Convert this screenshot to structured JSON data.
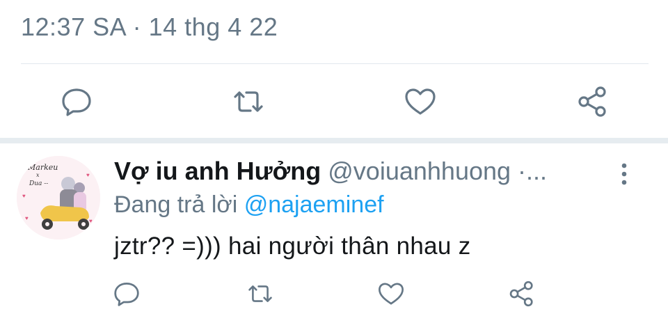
{
  "tweet": {
    "timestamp": "12:37 SA · 14 thg 4 22",
    "actions": [
      "reply-icon",
      "retweet-icon",
      "like-icon",
      "share-icon"
    ]
  },
  "reply": {
    "display_name": "Vợ iu anh Hưởng",
    "handle": "@voiuanhhuong",
    "dots": " ·...",
    "replying_prefix": "Đang trả lời ",
    "replying_to": "@najaeminef",
    "text": "jztr?? =))) hai người thân nhau z",
    "avatar_caption": [
      "Markeu",
      "x",
      "Dua --"
    ],
    "actions": [
      "reply-icon",
      "retweet-icon",
      "like-icon",
      "share-icon"
    ]
  },
  "colors": {
    "icon": "#657786",
    "link": "#1da1f2",
    "separator": "#e6ecf0"
  }
}
